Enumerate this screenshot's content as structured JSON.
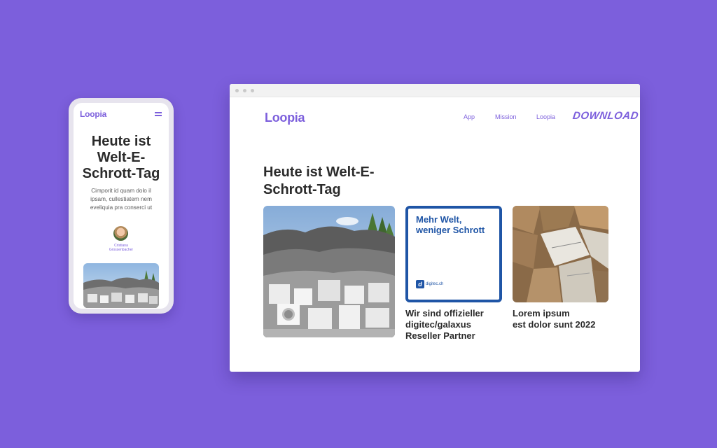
{
  "colors": {
    "background": "#7c5fdc",
    "accent": "#7c5fdc",
    "text": "#2b2b2b",
    "digitec_blue": "#1f55a6"
  },
  "mobile": {
    "logo": "Loopia",
    "menu_icon": "hamburger-icon",
    "title_lines": [
      "Heute ist",
      "Welt-E-",
      "Schrott-Tag"
    ],
    "text_lines": [
      "Cimporit id quam dolo il",
      "ipsam, cullestiatem nem",
      "eveliquia pra conserci ut"
    ],
    "author_lines": [
      "Cristiana",
      "Grossenbacher"
    ]
  },
  "desktop": {
    "logo": "Loopia",
    "nav": {
      "app": "App",
      "mission": "Mission",
      "loopia": "Loopia",
      "download": "DOWNLOAD"
    },
    "headline_lines": [
      "Heute ist Welt-E-",
      "Schrott-Tag"
    ],
    "cards": [
      {
        "image": "e-waste-pile-photo",
        "caption_lines": []
      },
      {
        "image": "digitec-ad",
        "ad_title_lines": [
          "Mehr Welt,",
          "weniger Schrott"
        ],
        "ad_logo": "d",
        "ad_site": "digitec.ch",
        "caption_lines": [
          "Wir sind offizieller",
          "digitec/galaxus",
          "Reseller Partner"
        ]
      },
      {
        "image": "cardboard-boxes-photo",
        "caption_lines": [
          "Lorem ipsum",
          "est dolor sunt 2022"
        ]
      }
    ]
  }
}
